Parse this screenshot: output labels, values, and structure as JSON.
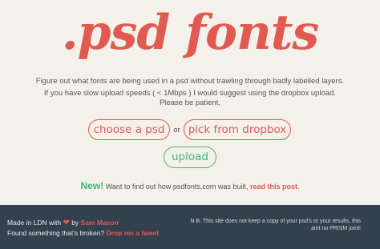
{
  "header": {
    "logo_text": ".psd fonts"
  },
  "intro": {
    "line1": "Figure out what fonts are being used in a psd without trawling through badly labelled layers.",
    "line2": "If you have slow upload speeds ( < 1Mbps ) I would suggest using the dropbox upload.",
    "line3": "Please be patient."
  },
  "actions": {
    "choose_label": "choose a psd",
    "or_label": "or",
    "dropbox_label": "pick from dropbox",
    "upload_label": "upload"
  },
  "news": {
    "badge": "New!",
    "text": " Want to find out how psdfonts.com was built, ",
    "link": "read this post",
    "end": "."
  },
  "footer": {
    "made_prefix": "Made in LDN with ",
    "heart_icon": "heart-icon",
    "by": " by ",
    "author": "Sam Mason",
    "broken_text": "Found something that's broken? ",
    "broken_link": "Drop me a tweet",
    "notice": "N.B. This site does not keep a copy of your psd's or your results, this aint no PRISM joint!"
  },
  "colors": {
    "accent": "#e05a52",
    "green": "#3cb878",
    "footer_bg": "#33414f",
    "page_bg": "#f3f1ea"
  }
}
